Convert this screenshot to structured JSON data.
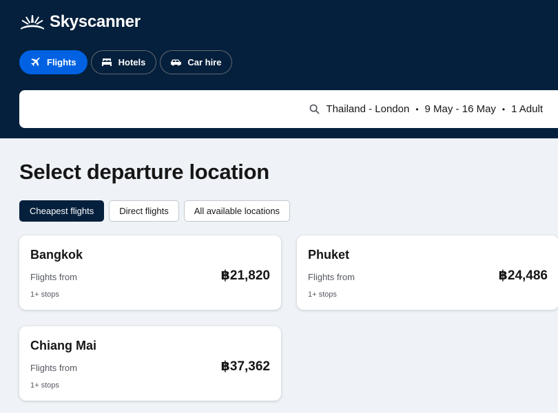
{
  "brand": {
    "name": "Skyscanner",
    "color": "#05203c",
    "accent": "#0062e3"
  },
  "nav": {
    "tabs": [
      {
        "label": "Flights",
        "icon": "plane-icon",
        "active": true
      },
      {
        "label": "Hotels",
        "icon": "bed-icon",
        "active": false
      },
      {
        "label": "Car hire",
        "icon": "car-icon",
        "active": false
      }
    ]
  },
  "search": {
    "route": "Thailand - London",
    "dates": "9 May - 16 May",
    "travellers": "1 Adult",
    "separator": "•",
    "icon": "search-icon"
  },
  "main": {
    "title": "Select departure location",
    "filters": [
      {
        "label": "Cheapest flights",
        "active": true
      },
      {
        "label": "Direct flights",
        "active": false
      },
      {
        "label": "All available locations",
        "active": false
      }
    ],
    "results": [
      {
        "city": "Bangkok",
        "from_label": "Flights from",
        "price": "฿21,820",
        "stops": "1+ stops"
      },
      {
        "city": "Phuket",
        "from_label": "Flights from",
        "price": "฿24,486",
        "stops": "1+ stops"
      },
      {
        "city": "Chiang Mai",
        "from_label": "Flights from",
        "price": "฿37,362",
        "stops": "1+ stops"
      }
    ]
  }
}
